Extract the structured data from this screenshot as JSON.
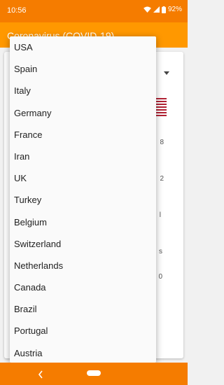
{
  "status_bar": {
    "time": "10:56",
    "battery": "92%",
    "icons": [
      "wifi-icon",
      "signal-icon",
      "battery-icon"
    ]
  },
  "app_bar": {
    "title": "Coronavirus (COVID-19)"
  },
  "dropdown": {
    "items": [
      "USA",
      "Spain",
      "Italy",
      "Germany",
      "France",
      "Iran",
      "UK",
      "Turkey",
      "Belgium",
      "Switzerland",
      "Netherlands",
      "Canada",
      "Brazil",
      "Portugal",
      "Austria"
    ]
  },
  "background_card": {
    "peek_values": [
      "8",
      "2",
      "l",
      "s",
      "0"
    ]
  },
  "colors": {
    "status_bar": "#f57c00",
    "app_bar": "#ff9800",
    "flag_red": "#b22234"
  }
}
